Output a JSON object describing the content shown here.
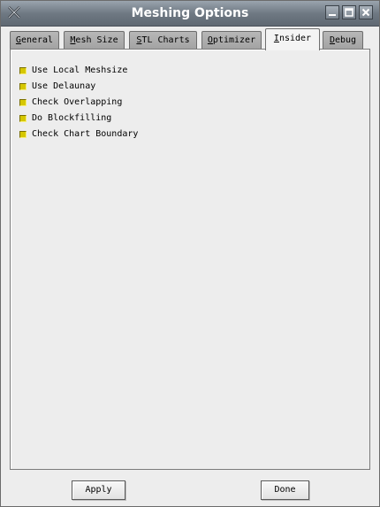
{
  "window": {
    "title": "Meshing Options",
    "buttons": [
      "minimize-icon",
      "maximize-icon",
      "close-icon"
    ]
  },
  "tabs": [
    {
      "label_hotkey": "G",
      "label_rest": "eneral",
      "active": false
    },
    {
      "label_hotkey": "M",
      "label_rest": "esh Size",
      "active": false
    },
    {
      "label_hotkey": "S",
      "label_rest": "TL Charts",
      "active": false
    },
    {
      "label_hotkey": "O",
      "label_rest": "ptimizer",
      "active": false
    },
    {
      "label_hotkey": "I",
      "label_rest": "nsider",
      "active": true
    },
    {
      "label_hotkey": "D",
      "label_rest": "ebug",
      "active": false
    }
  ],
  "options": [
    {
      "label": "Use Local Meshsize",
      "checked": true
    },
    {
      "label": "Use Delaunay",
      "checked": true
    },
    {
      "label": "Check Overlapping",
      "checked": true
    },
    {
      "label": "Do Blockfilling",
      "checked": true
    },
    {
      "label": "Check Chart Boundary",
      "checked": true
    }
  ],
  "footer": {
    "apply_label": "Apply",
    "done_label": "Done"
  },
  "colors": {
    "checkbox_fill": "#d6c700",
    "titlebar": "#6f7983"
  }
}
